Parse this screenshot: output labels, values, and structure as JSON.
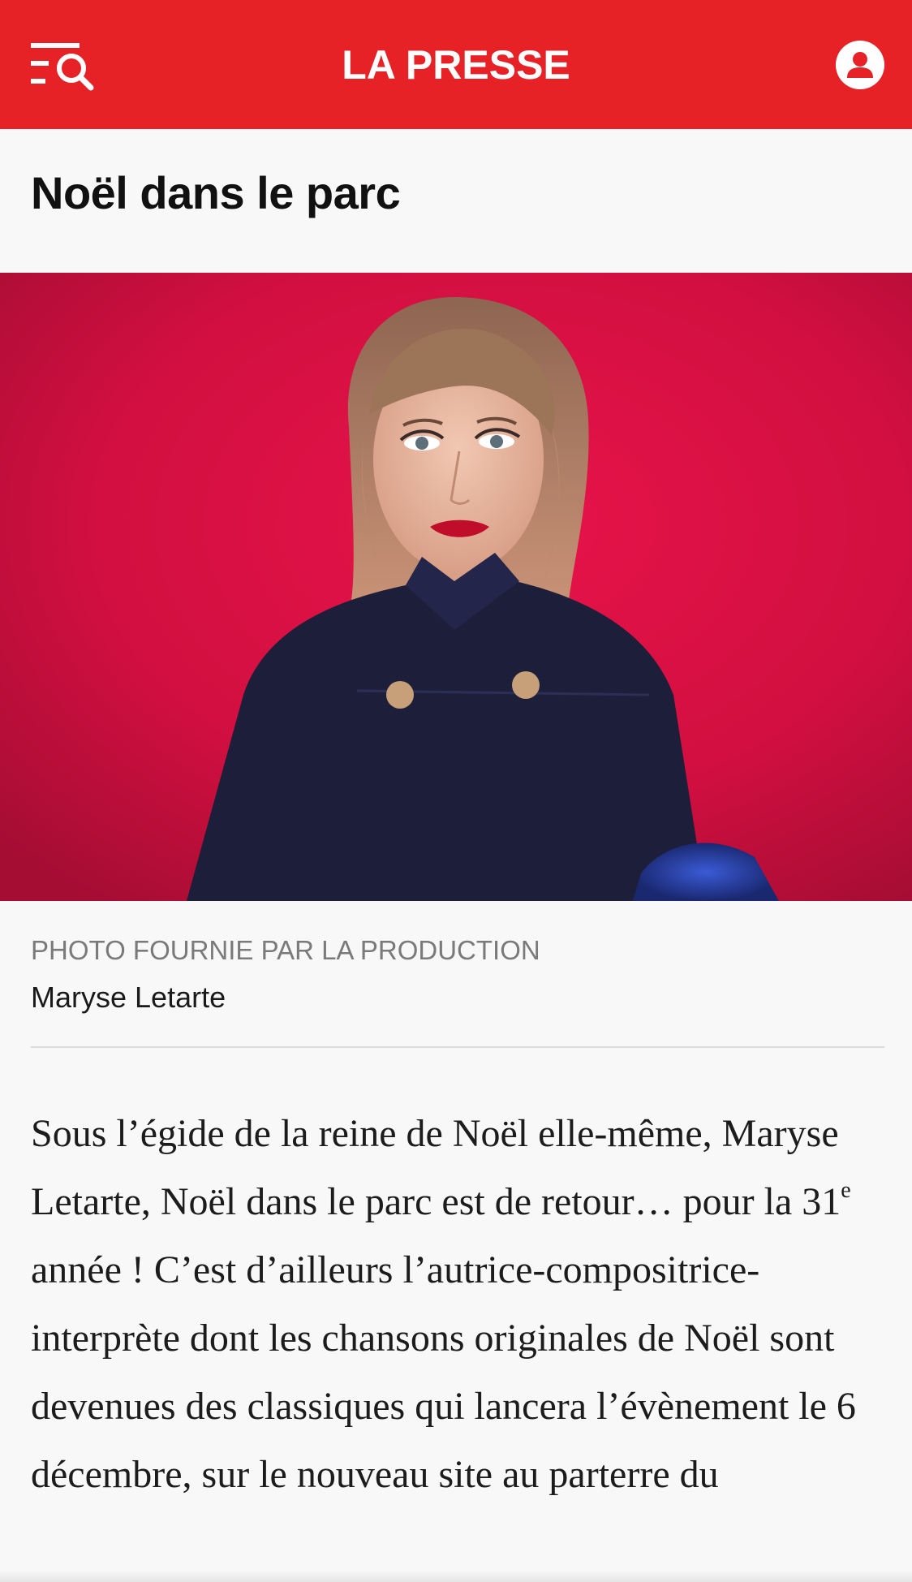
{
  "header": {
    "brand": "LA PRESSE",
    "menu_icon": "menu-search-icon",
    "account_icon": "user-account-icon",
    "background_color": "#e62227"
  },
  "article": {
    "title": "Noël dans le parc",
    "photo": {
      "credit": "PHOTO FOURNIE PAR LA PRODUCTION",
      "caption": "Maryse Letarte"
    },
    "body": {
      "part1": "Sous l’égide de la reine de Noël elle-même, Maryse Letarte, Noël dans le parc est de retour… pour la 31",
      "superscript": "e",
      "part2": " année ! C’est d’ailleurs l’autrice-compositrice-interprète dont les chansons originales de Noël sont devenues des classiques qui lancera l’évènement le 6 décembre, sur le nouveau site au parterre du"
    }
  }
}
